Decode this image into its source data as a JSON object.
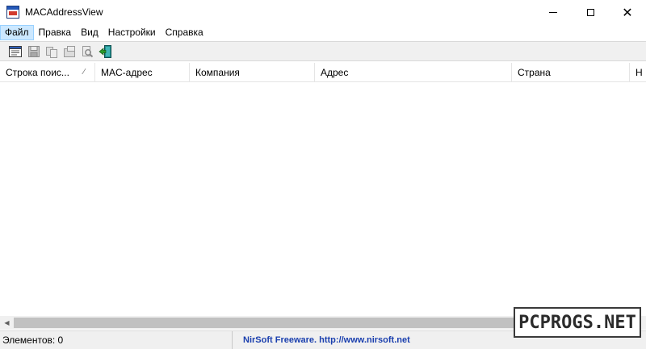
{
  "window": {
    "title": "MACAddressView"
  },
  "menu": {
    "items": [
      {
        "label": "Файл"
      },
      {
        "label": "Правка"
      },
      {
        "label": "Вид"
      },
      {
        "label": "Настройки"
      },
      {
        "label": "Справка"
      }
    ]
  },
  "toolbar": {
    "buttons": [
      {
        "icon": "properties-icon"
      },
      {
        "icon": "save-icon"
      },
      {
        "icon": "copy-icon"
      },
      {
        "icon": "html-report-icon"
      },
      {
        "icon": "find-icon"
      },
      {
        "icon": "exit-icon"
      }
    ]
  },
  "list": {
    "columns": [
      {
        "label": "Строка поис..."
      },
      {
        "label": "MAC-адрес"
      },
      {
        "label": "Компания"
      },
      {
        "label": "Адрес"
      },
      {
        "label": "Страна"
      },
      {
        "label": "Н"
      }
    ],
    "rows": []
  },
  "statusbar": {
    "items_count": "Элементов: 0",
    "credit": "NirSoft Freeware.  http://www.nirsoft.net"
  },
  "watermark": {
    "text": "PCPROGS.NET"
  },
  "colors": {
    "menu_active_bg": "#cce8ff",
    "credit_text": "#1a3fae",
    "toolbar_bg": "#f0f0f0"
  }
}
